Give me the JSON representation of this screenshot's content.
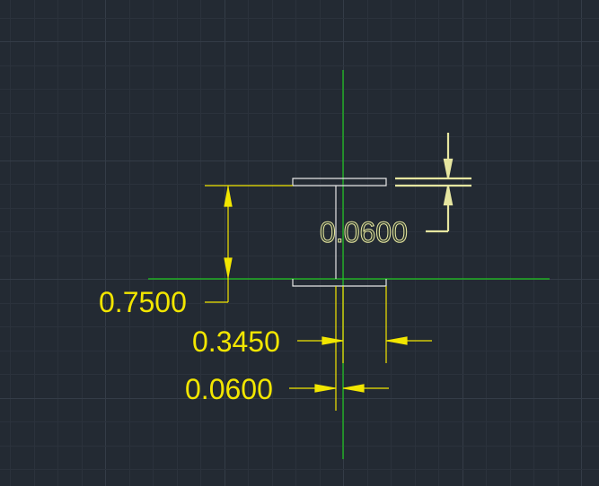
{
  "colors": {
    "background": "#232a33",
    "grid_minor": "#2b323c",
    "grid_major": "#343c47",
    "axis": "#1ec81e",
    "geometry": "#e6e6e6",
    "dimension": "#f2e600",
    "selected_dimension": "#e6e6a0"
  },
  "dimensions": {
    "height": "0.7500",
    "flange_width": "0.3450",
    "web_thickness": "0.0600",
    "flange_thickness": "0.0600"
  }
}
